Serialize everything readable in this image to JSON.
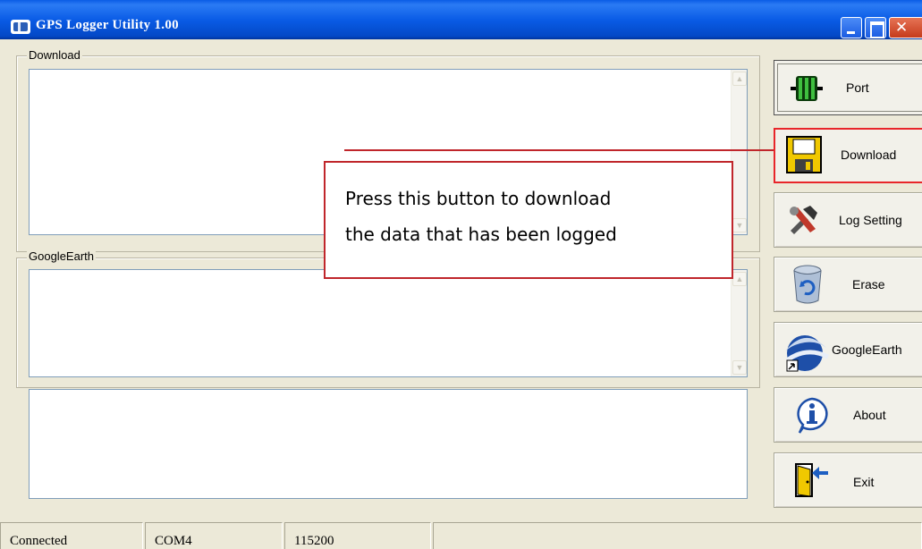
{
  "window": {
    "title": "GPS Logger Utility 1.00",
    "icon": "satellite-dish-icon"
  },
  "download_group": {
    "legend": "Download"
  },
  "googleearth_group": {
    "legend": "GoogleEarth"
  },
  "buttons": [
    {
      "label": "Port",
      "icon": "port-connector-icon"
    },
    {
      "label": "Download",
      "icon": "floppy-disk-icon"
    },
    {
      "label": "Log Setting",
      "icon": "tools-icon"
    },
    {
      "label": "Erase",
      "icon": "recycle-bin-icon"
    },
    {
      "label": "GoogleEarth",
      "icon": "googleearth-icon"
    },
    {
      "label": "About",
      "icon": "info-icon"
    },
    {
      "label": "Exit",
      "icon": "exit-door-icon"
    }
  ],
  "callout": {
    "line1": "Press this button to download",
    "line2": "the data that has been logged",
    "color": "#c0262b"
  },
  "statusbar": {
    "status": "Connected",
    "port": "COM4",
    "baud": "115200",
    "extra": ""
  }
}
